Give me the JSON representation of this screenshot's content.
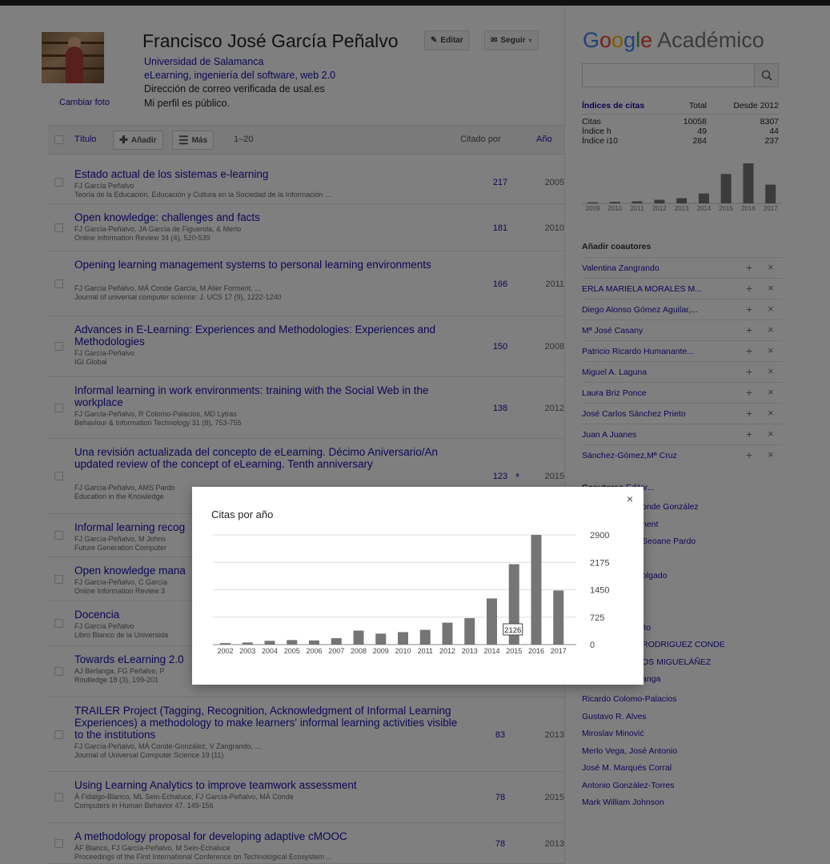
{
  "profile": {
    "name": "Francisco José García Peñalvo",
    "affiliation": "Universidad de Salamanca",
    "interests": "eLearning, ingeniería del software, web 2.0",
    "email": "Dirección de correo verificada de usal.es",
    "public": "Mi perfil es público.",
    "change_photo": "Cambiar foto",
    "edit": "Editar",
    "follow": "Seguir"
  },
  "table": {
    "title_col": "Título",
    "add": "Añadir",
    "more": "Más",
    "range": "1–20",
    "cited_col": "Citado por",
    "year_col": "Año"
  },
  "articles": [
    {
      "title": "Estado actual de los sistemas e-learning",
      "authors": "FJ García Peñalvo",
      "venue": "Teoría de la Educación. Educación y Cultura en la Sociedad de la Información ...",
      "cited": "217",
      "year": "2005"
    },
    {
      "title": "Open knowledge: challenges and facts",
      "authors": "FJ García-Peñalvo, JA García de Figuerola, & Merlo",
      "venue": "Online Information Review 34 (4), 520-539",
      "cited": "181",
      "year": "2010"
    },
    {
      "title": "Opening learning management systems to personal learning environments",
      "authors": "FJ García Peñalvo, MÁ Conde García, M Alier Forment, ...",
      "venue": "Journal of universal computer science: J. UCS 17 (9), 1222-1240",
      "cited": "166",
      "year": "2011"
    },
    {
      "title": "Advances in E-Learning: Experiences and Methodologies: Experiences and Methodologies",
      "authors": "FJ García-Peñalvo",
      "venue": "IGI Global",
      "cited": "150",
      "year": "2008"
    },
    {
      "title": "Informal learning in work environments: training with the Social Web in the workplace",
      "authors": "FJ García-Peñalvo, R Colomo-Palacios, MD Lytras",
      "venue": "Behaviour & Information Technology 31 (8), 753-755",
      "cited": "138",
      "year": "2012"
    },
    {
      "title": "Una revisión actualizada del concepto de eLearning. Décimo Aniversario/An updated review of the concept of eLearning. Tenth anniversary",
      "authors": "FJ García-Peñalvo, AMS Pardo",
      "venue": "Education in the Knowledge",
      "cited": "123",
      "year": "2015",
      "star": "*"
    },
    {
      "title": "Informal learning recog",
      "authors": "FJ García-Peñalvo, M Johns",
      "venue": "Future Generation Computer",
      "cited": "",
      "year": ""
    },
    {
      "title": "Open knowledge mana",
      "authors": "FJ García-Peñalvo, C García",
      "venue": "Online Information Review 3",
      "cited": "",
      "year": ""
    },
    {
      "title": "Docencia",
      "authors": "FJ García Peñalvo",
      "venue": "Libro Blanco de la Universida",
      "cited": "",
      "year": ""
    },
    {
      "title": "Towards eLearning 2.0",
      "authors": "AJ Berlanga, FG Peñalvo, P",
      "venue": "Routledge 18 (3), 199-201",
      "cited": "",
      "year": ""
    },
    {
      "title": "TRAILER Project (Tagging, Recognition, Acknowledgment of Informal Learning Experiences) a methodology to make learners' informal learning activities visible to the institutions",
      "authors": "FJ García-Peñalvo, MÁ Conde-González, V Zangrando, ...",
      "venue": "Journal of Universal Computer Science 19 (11)",
      "cited": "83",
      "year": "2013"
    },
    {
      "title": "Using Learning Analytics to improve teamwork assessment",
      "authors": "Á Fidalgo-Blanco, ML Sein-Echaluce, FJ García-Peñalvo, MÁ Conde",
      "venue": "Computers in Human Behavior 47, 149-156",
      "cited": "78",
      "year": "2015"
    },
    {
      "title": "A methodology proposal for developing adaptive cMOOC",
      "authors": "ÁF Blanco, FJ García-Peñalvo, M Sein-Echaluce",
      "venue": "Proceedings of the First International Conference on Technological Ecosystem ...",
      "cited": "78",
      "year": "2013"
    }
  ],
  "sidebar": {
    "logo_google": "Google",
    "logo_academico": "Académico",
    "stats_header": [
      "Índices de citas",
      "Total",
      "Desde 2012"
    ],
    "stats": [
      [
        "Citas",
        "10058",
        "8307"
      ],
      [
        "Índice h",
        "49",
        "44"
      ],
      [
        "Índice i10",
        "284",
        "237"
      ]
    ],
    "mini_years": [
      "2009",
      "2010",
      "2011",
      "2012",
      "2013",
      "2014",
      "2015",
      "2016",
      "2017"
    ],
    "mini_values": [
      80,
      110,
      150,
      260,
      380,
      720,
      2126,
      2900,
      1360
    ],
    "add_coauthors": "Añadir coautores",
    "suggested": [
      "Valentina Zangrando",
      "ERLA MARIELA MORALES M...",
      "Diego Alonso Gómez Aguilar,...",
      "Mª José Casany",
      "Patricio Ricardo Humanante...",
      "Miguel A. Laguna",
      "Laura Briz Ponce",
      "José Carlos Sánchez Prieto",
      "Juan A Juanes",
      "Sánchez-Gómez,Mª Cruz"
    ],
    "coauthors_head": "Coautores",
    "coauthors_edit": "Editar...",
    "coauthors_partial": [
      "onde González",
      "nent",
      "Seoane Pardo",
      "",
      "olgado",
      "",
      "",
      "ito",
      "RODRIGUEZ CONDE",
      "OS MIGUELÁÑEZ",
      "anga"
    ],
    "coauthors": [
      "Ricardo Colomo-Palacios",
      "Gustavo R. Alves",
      "Miroslav Minović",
      "Merlo Vega, José Antonio",
      "José M. Marqués Corral",
      "Antonio González-Torres",
      "Mark William Johnson"
    ]
  },
  "modal": {
    "title": "Citas por año",
    "close": "×",
    "tooltip": "2126"
  },
  "chart_data": {
    "type": "bar",
    "title": "Citas por año",
    "categories": [
      "2002",
      "2003",
      "2004",
      "2005",
      "2006",
      "2007",
      "2008",
      "2009",
      "2010",
      "2011",
      "2012",
      "2013",
      "2014",
      "2015",
      "2016",
      "2017"
    ],
    "values": [
      40,
      55,
      100,
      120,
      110,
      170,
      370,
      290,
      330,
      390,
      580,
      700,
      1220,
      2126,
      2900,
      1430
    ],
    "yticks": [
      "0",
      "725",
      "1450",
      "2175",
      "2900"
    ],
    "ylim": [
      0,
      2900
    ],
    "highlight": {
      "category": "2015",
      "label": "2126"
    },
    "color": "#757575"
  }
}
